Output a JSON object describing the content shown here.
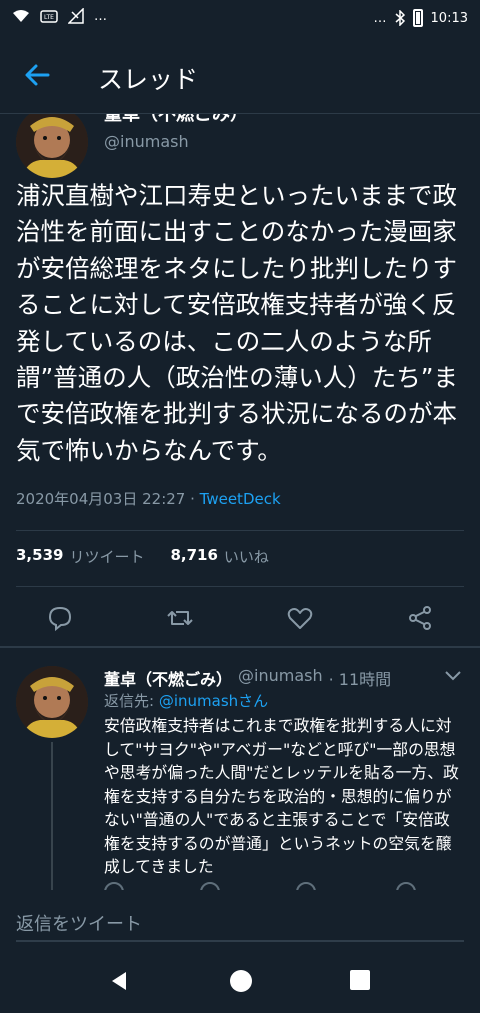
{
  "status_bar": {
    "time": "10:13",
    "left_icons": [
      "wifi-icon",
      "volte-icon",
      "signal-icon"
    ],
    "more_left": "…",
    "more_right": "…"
  },
  "app_bar": {
    "title": "スレッド",
    "back_icon": "arrow-left-icon"
  },
  "main_tweet": {
    "author_name": "董卓（不燃ごみ）",
    "handle": "@inumash",
    "text": "浦沢直樹や江口寿史といったいままで政治性を前面に出すことのなかった漫画家が安倍総理をネタにしたり批判したりすることに対して安倍政権支持者が強く反発しているのは、この二人のような所謂”普通の人（政治性の薄い人）たち”まで安倍政権を批判する状況になるのが本気で怖いからなんです。",
    "timestamp": "2020年04月03日 22:27",
    "separator": " · ",
    "source": "TweetDeck",
    "retweet_count": "3,539",
    "retweet_label": "リツイート",
    "like_count": "8,716",
    "like_label": "いいね"
  },
  "actions": [
    "reply-icon",
    "retweet-icon",
    "like-icon",
    "share-icon"
  ],
  "reply_tweet": {
    "author_name": "董卓（不燃ごみ）",
    "handle": "@inumash",
    "time": "· 11時間",
    "reply_to_prefix": "返信先: ",
    "reply_to_handle": "@inumashさん",
    "text": "安倍政権支持者はこれまで政権を批判する人に対して\"サヨク\"や\"アベガー\"などと呼び\"一部の思想や思考が偏った人間\"だとレッテルを貼る一方、政権を支持する自分たちを政治的・思想的に偏りがない\"普通の人\"であると主張することで「安倍政権を支持するのが普通」というネットの空気を醸成してきました"
  },
  "reply_bar": {
    "placeholder": "返信をツイート"
  },
  "nav": [
    "back-triangle-icon",
    "home-circle-icon",
    "recents-square-icon"
  ]
}
